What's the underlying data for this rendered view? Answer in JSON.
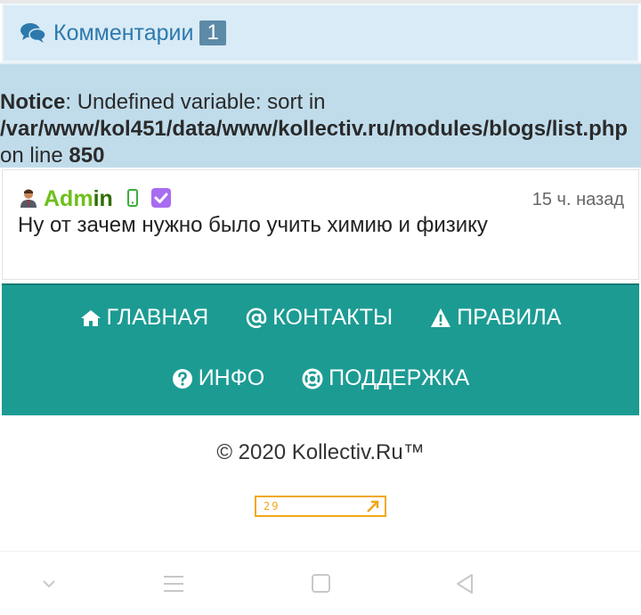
{
  "comments_header": {
    "title": "Комментарии",
    "count": "1"
  },
  "notice": {
    "label": "Notice",
    "message": ": Undefined variable: sort in",
    "path": "/var/www/kol451/data/www/kollectiv.ru/modules/blogs/list.php",
    "line_prefix": "on line ",
    "line_number": "850"
  },
  "comment": {
    "author_part1": "Adm",
    "author_part2": "in",
    "time": "15 ч. назад",
    "text": "Ну от зачем нужно было учить химию и физику"
  },
  "footer_nav": {
    "home": "ГЛАВНАЯ",
    "contacts": "КОНТАКТЫ",
    "rules": "ПРАВИЛА",
    "info": "ИНФО",
    "support": "ПОДДЕРЖКА"
  },
  "copyright": "© 2020 Kollectiv.Ru™",
  "counter": {
    "value": "29"
  },
  "colors": {
    "teal": "#1c9b93",
    "notice_bg": "#c0dceb",
    "header_bg": "#d9ebf6",
    "accent_blue": "#2d79ad",
    "counter_orange": "#f0a819"
  }
}
